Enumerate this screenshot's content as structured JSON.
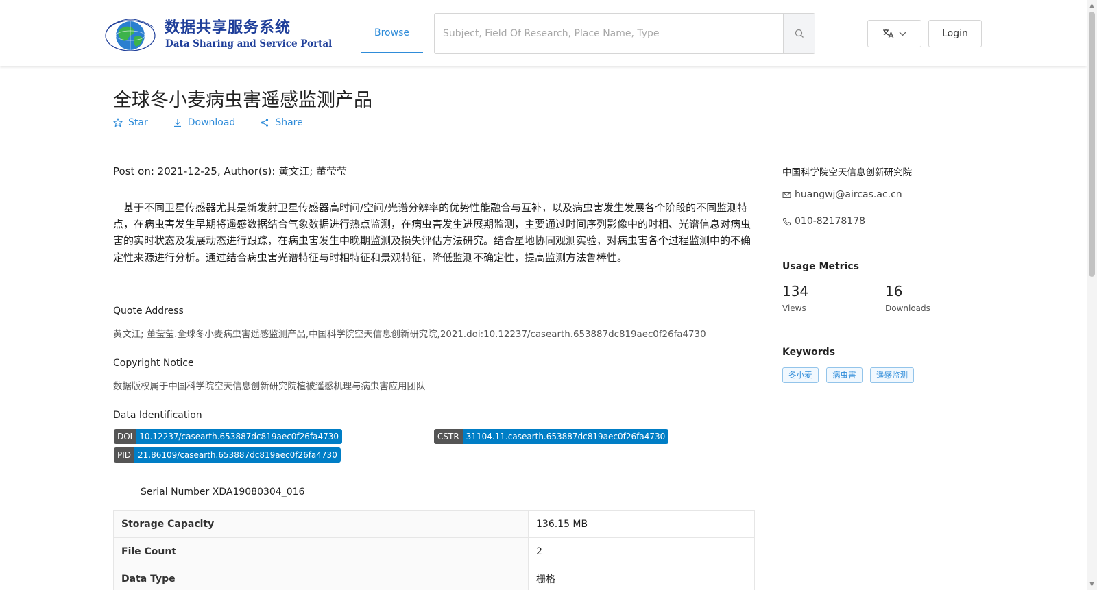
{
  "header": {
    "logo_cn": "数据共享服务系统",
    "logo_en": "Data Sharing and Service Portal",
    "logo_icon": "globe-logo-icon",
    "nav_browse": "Browse",
    "search_placeholder": "Subject, Field Of Research, Place Name, Type",
    "search_icon": "search-icon",
    "language_icon": "translate-icon",
    "login_label": "Login",
    "accent_color": "#2f8cd9"
  },
  "dataset": {
    "title": "全球冬小麦病虫害遥感监测产品",
    "actions": {
      "star": "Star",
      "download": "Download",
      "share": "Share"
    },
    "post_line": "Post on: 2021-12-25, Author(s): 黄文江; 董莹莹",
    "abstract": "基于不同卫星传感器尤其是新发射卫星传感器高时间/空间/光谱分辨率的优势性能融合与互补，以及病虫害发生发展各个阶段的不同监测特点，在病虫害发生早期将遥感数据结合气象数据进行热点监测，在病虫害发生进展期监测，主要通过时间序列影像中的时相、光谱信息对病虫害的实时状态及发展动态进行跟踪，在病虫害发生中晚期监测及损失评估方法研究。结合星地协同观测实验，对病虫害各个过程监测中的不确定性来源进行分析。通过结合病虫害光谱特征与时相特征和景观特征，降低监测不确定性，提高监测方法鲁棒性。",
    "quote_heading": "Quote Address",
    "quote_text": "黄文江; 董莹莹.全球冬小麦病虫害遥感监测产品,中国科学院空天信息创新研究院,2021.doi:10.12237/casearth.653887dc819aec0f26fa4730",
    "copyright_heading": "Copyright Notice",
    "copyright_text": "数据版权属于中国科学院空天信息创新研究院植被遥感机理与病虫害应用团队",
    "identification_heading": "Data Identification",
    "identifiers": {
      "doi": {
        "key": "DOI",
        "value": "10.12237/casearth.653887dc819aec0f26fa4730"
      },
      "cstr": {
        "key": "CSTR",
        "value": "31104.11.casearth.653887dc819aec0f26fa4730"
      },
      "pid": {
        "key": "PID",
        "value": "21.86109/casearth.653887dc819aec0f26fa4730"
      }
    },
    "serial_number": "Serial Number XDA19080304_016",
    "info_table": [
      {
        "key": "Storage Capacity",
        "value": "136.15 MB"
      },
      {
        "key": "File Count",
        "value": "2"
      },
      {
        "key": "Data Type",
        "value": "栅格"
      }
    ]
  },
  "sidebar": {
    "organization": "中国科学院空天信息创新研究院",
    "email": "huangwj@aircas.ac.cn",
    "phone": "010-82178178",
    "metrics_heading": "Usage Metrics",
    "views_count": "134",
    "views_label": "Views",
    "downloads_count": "16",
    "downloads_label": "Downloads",
    "keywords_heading": "Keywords",
    "keywords": [
      "冬小麦",
      "病虫害",
      "遥感监测"
    ]
  }
}
